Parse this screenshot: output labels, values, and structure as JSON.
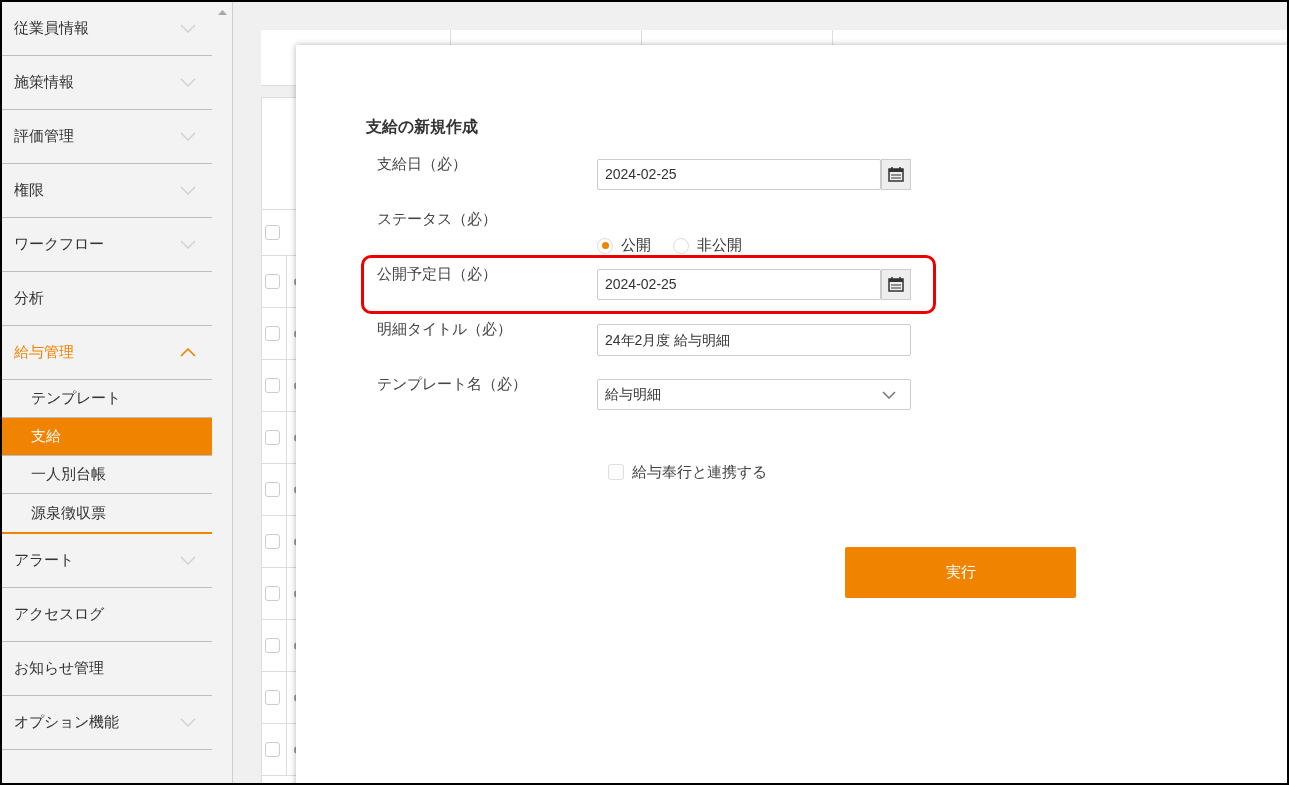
{
  "sidebar": {
    "items": [
      {
        "label": "従業員情報",
        "expandable": true,
        "expanded": false
      },
      {
        "label": "施策情報",
        "expandable": true,
        "expanded": false
      },
      {
        "label": "評価管理",
        "expandable": true,
        "expanded": false
      },
      {
        "label": "権限",
        "expandable": true,
        "expanded": false
      },
      {
        "label": "ワークフロー",
        "expandable": true,
        "expanded": false
      },
      {
        "label": "分析",
        "expandable": false,
        "expanded": false
      },
      {
        "label": "給与管理",
        "expandable": true,
        "expanded": true,
        "children": [
          {
            "label": "テンプレート",
            "selected": false
          },
          {
            "label": "支給",
            "selected": true
          },
          {
            "label": "一人別台帳",
            "selected": false
          },
          {
            "label": "源泉徴収票",
            "selected": false
          }
        ]
      },
      {
        "label": "アラート",
        "expandable": true,
        "expanded": false
      },
      {
        "label": "アクセスログ",
        "expandable": false,
        "expanded": false
      },
      {
        "label": "お知らせ管理",
        "expandable": false,
        "expanded": false
      },
      {
        "label": "オプション機能",
        "expandable": true,
        "expanded": false
      }
    ]
  },
  "background_table": {
    "header_checked": false,
    "rows": [
      {
        "checked": false
      },
      {
        "checked": false
      },
      {
        "checked": false
      },
      {
        "checked": false
      },
      {
        "checked": false
      },
      {
        "checked": false
      },
      {
        "checked": false
      },
      {
        "checked": false
      },
      {
        "checked": false
      },
      {
        "checked": false
      }
    ]
  },
  "dialog": {
    "title": "支給の新規作成",
    "rows": [
      {
        "kind": "date",
        "label": "支給日（必）",
        "value": "2024-02-25",
        "highlighted": false
      },
      {
        "kind": "radio",
        "label": "ステータス（必）",
        "options": [
          {
            "label": "公開",
            "selected": true
          },
          {
            "label": "非公開",
            "selected": false
          }
        ],
        "highlighted": false
      },
      {
        "kind": "date",
        "label": "公開予定日（必）",
        "value": "2024-02-25",
        "highlighted": true
      },
      {
        "kind": "text",
        "label": "明細タイトル（必）",
        "value": "24年2月度 給与明細",
        "highlighted": false
      },
      {
        "kind": "select",
        "label": "テンプレート名（必）",
        "value": "給与明細",
        "highlighted": false
      }
    ],
    "checkbox": {
      "label": "給与奉行と連携する",
      "checked": false
    },
    "submit_button": "実行"
  }
}
